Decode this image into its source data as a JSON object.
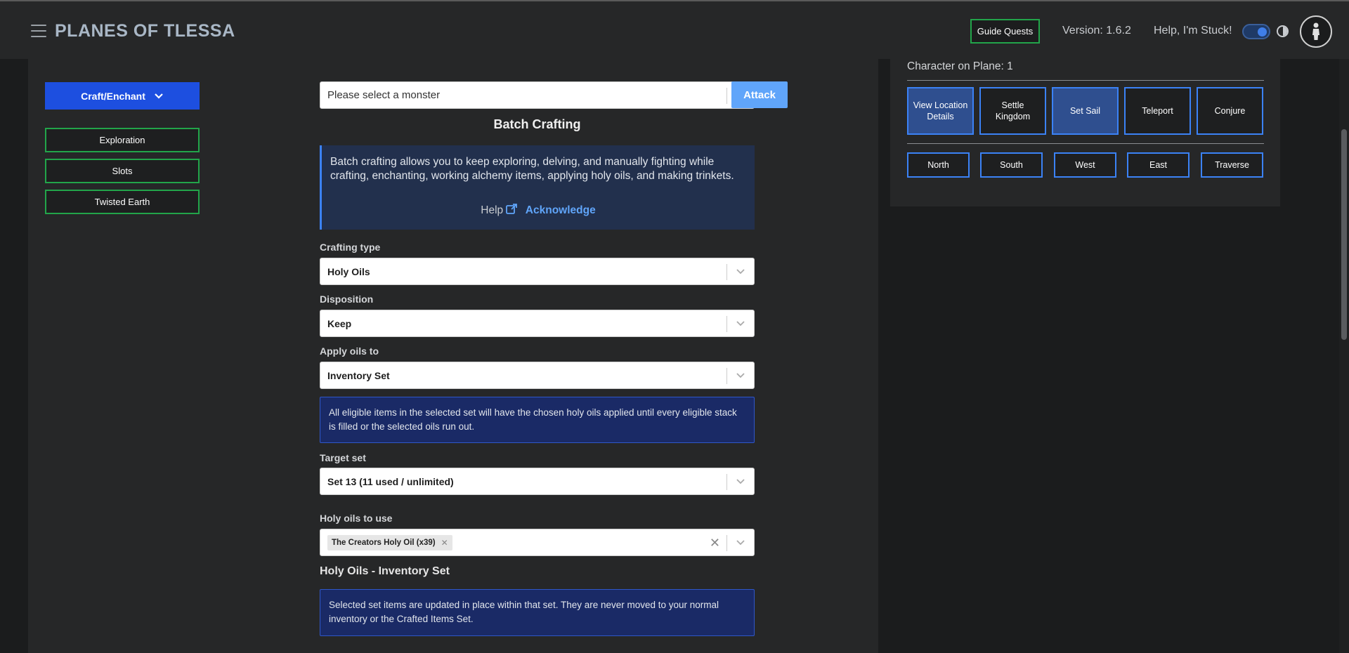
{
  "header": {
    "brand": "PLANES OF TLESSA",
    "guide_quests": "Guide Quests",
    "version": "Version: 1.6.2",
    "help_stuck": "Help, I'm Stuck!"
  },
  "sidebar": {
    "craft_enchant": "Craft/Enchant",
    "items": [
      "Exploration",
      "Slots",
      "Twisted Earth"
    ]
  },
  "monster_select": {
    "placeholder": "Please select a monster",
    "attack_label": "Attack"
  },
  "batch": {
    "title": "Batch Crafting",
    "info": "Batch crafting allows you to keep exploring, delving, and manually fighting while crafting, enchanting, working alchemy items, applying holy oils, and making trinkets.",
    "help_label": "Help",
    "acknowledge_label": "Acknowledge"
  },
  "form": {
    "crafting_type_label": "Crafting type",
    "crafting_type_value": "Holy Oils",
    "disposition_label": "Disposition",
    "disposition_value": "Keep",
    "apply_oils_label": "Apply oils to",
    "apply_oils_value": "Inventory Set",
    "apply_note": "All eligible items in the selected set will have the chosen holy oils applied until every eligible stack is filled or the selected oils run out.",
    "target_set_label": "Target set",
    "target_set_value": "Set 13 (11 used / unlimited)",
    "holy_oils_label": "Holy oils to use",
    "holy_oil_chip": "The Creators Holy Oil (x39)",
    "section_title": "Holy Oils - Inventory Set",
    "section_note": "Selected set items are updated in place within that set. They are never moved to your normal inventory or the Crafted Items Set."
  },
  "map_actions": {
    "plane_text": "Character on Plane: 1",
    "actions": [
      {
        "label": "View Location Details",
        "active": true
      },
      {
        "label": "Settle Kingdom",
        "active": false
      },
      {
        "label": "Set Sail",
        "active": true
      },
      {
        "label": "Teleport",
        "active": false
      },
      {
        "label": "Conjure",
        "active": false
      }
    ],
    "directions": [
      "North",
      "South",
      "West",
      "East",
      "Traverse"
    ]
  },
  "colors": {
    "primary_blue": "#1d4fe0",
    "accent_green": "#22a54a",
    "link_blue": "#60a5fa",
    "action_border": "#3b82f6"
  }
}
